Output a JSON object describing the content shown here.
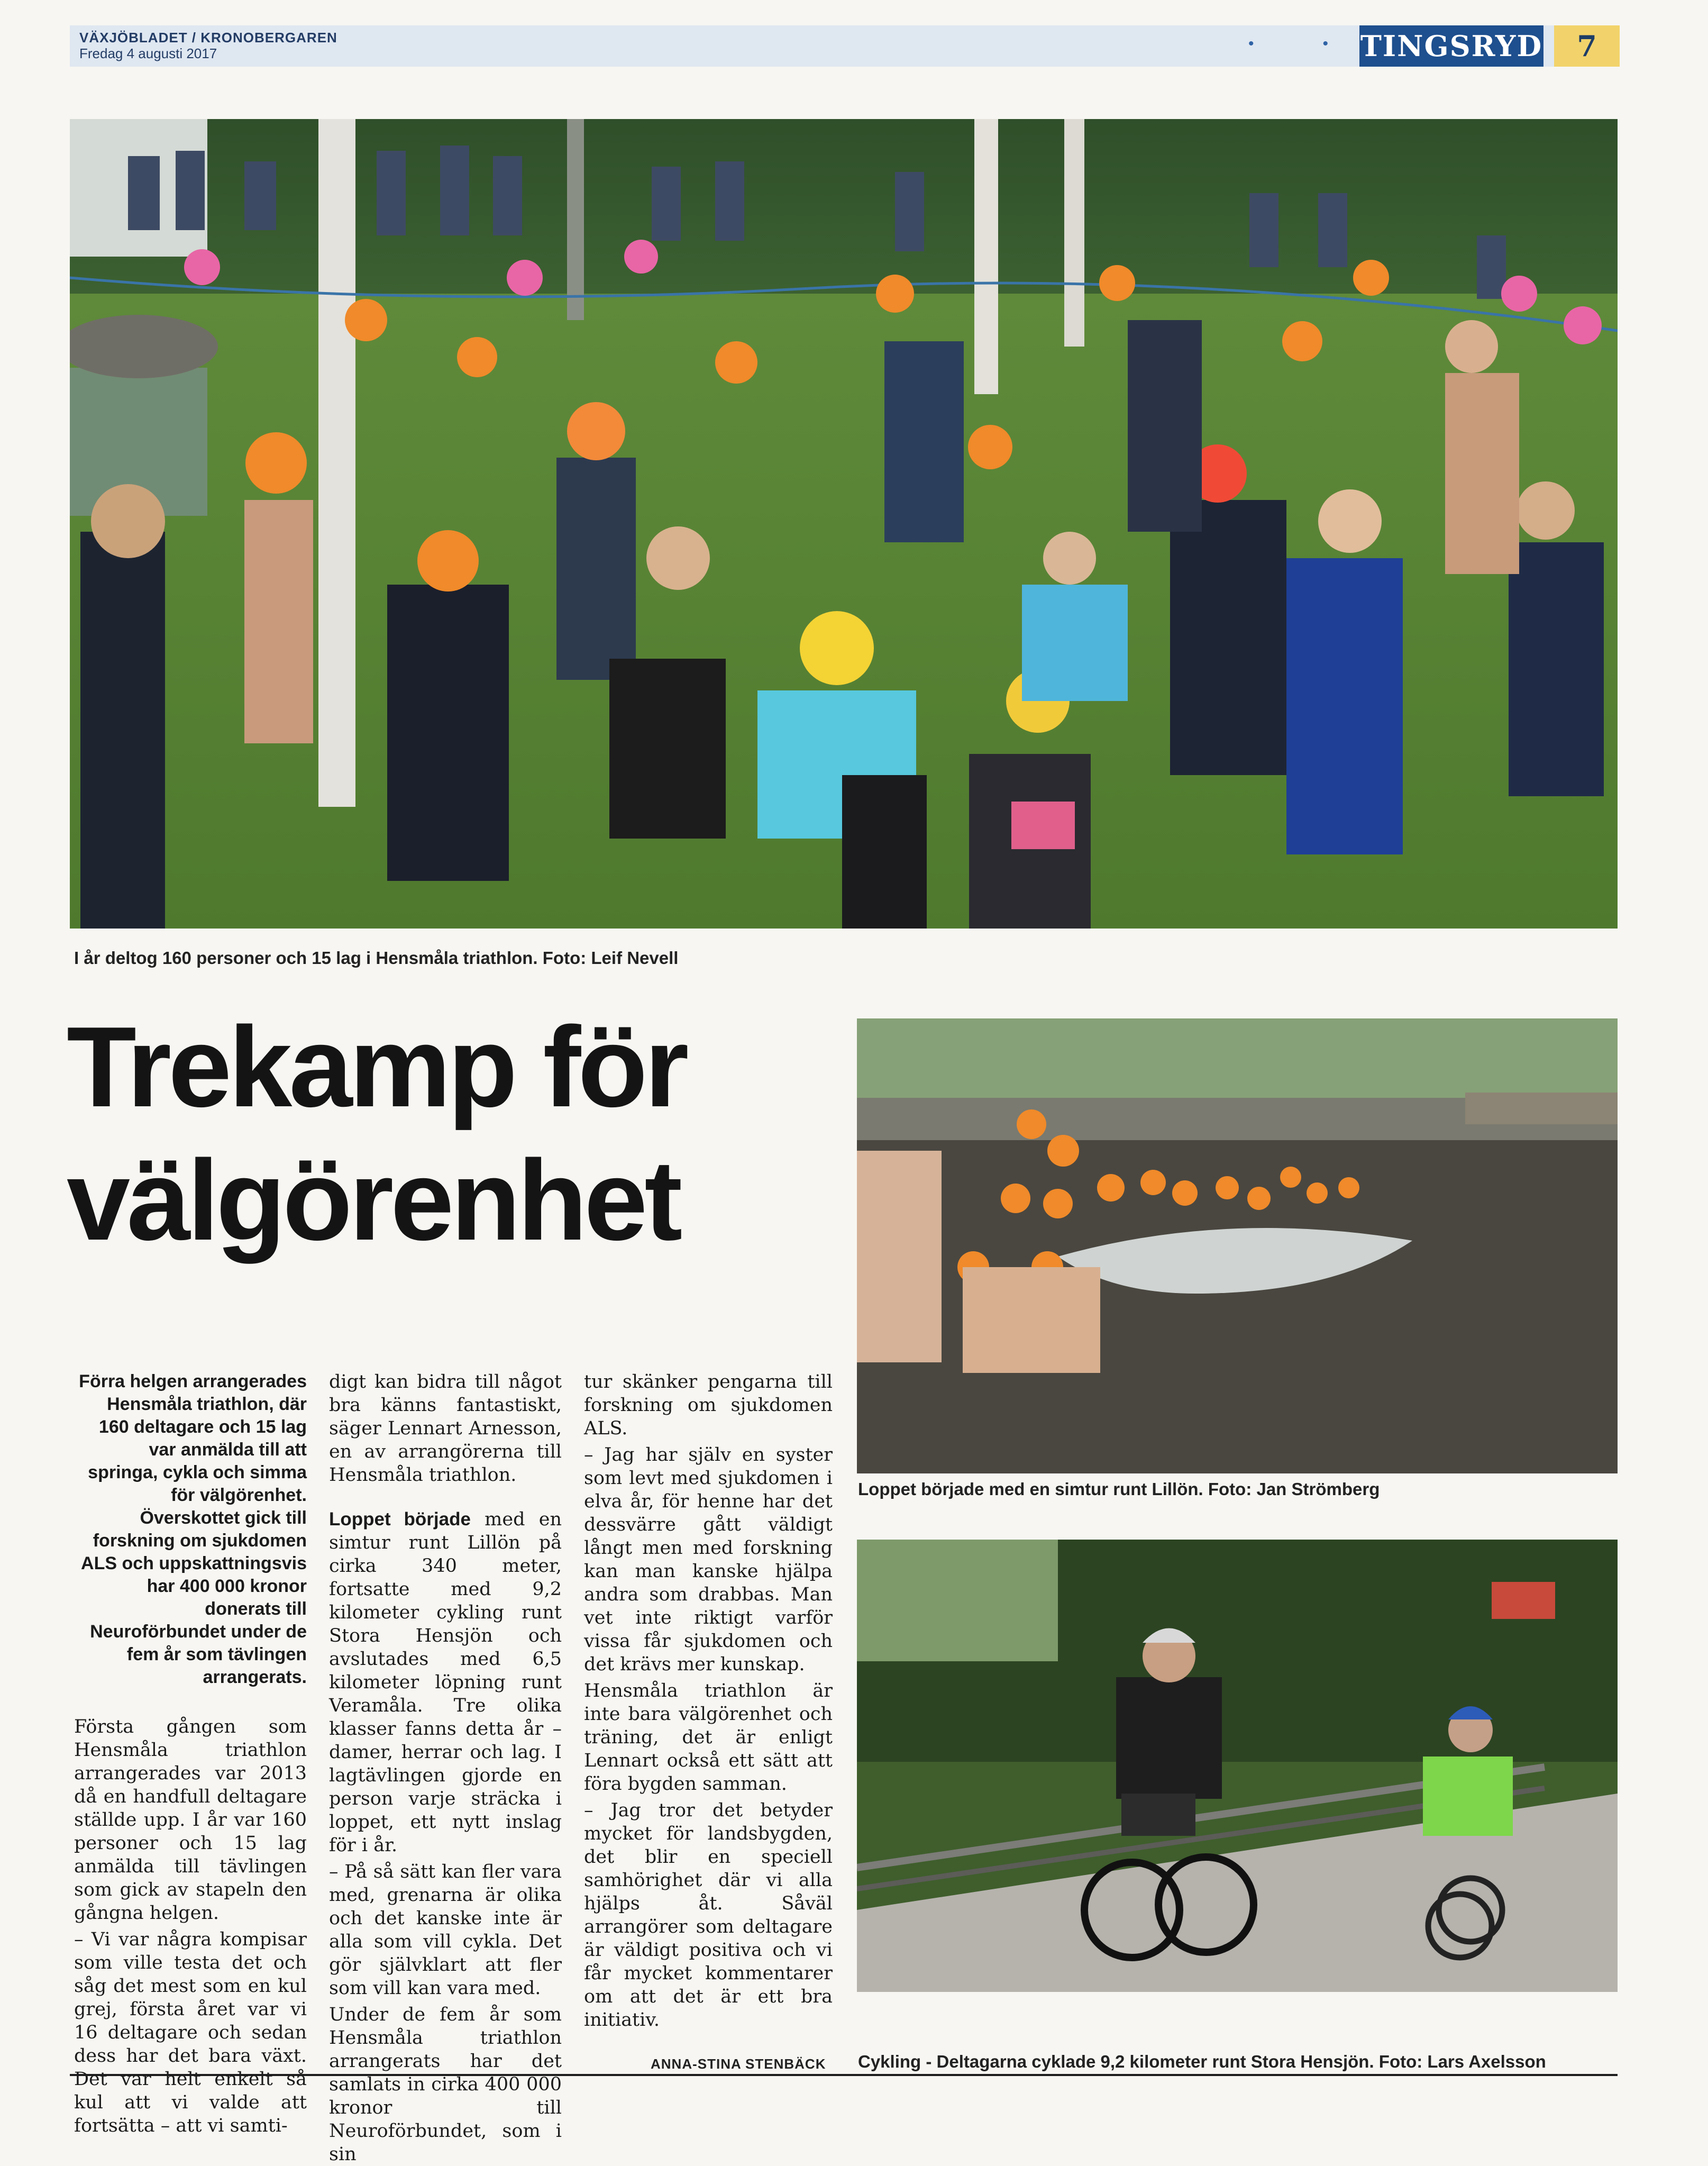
{
  "header": {
    "paper_name": "VÄXJÖBLADET / KRONOBERGAREN",
    "date": "Fredag 4 augusti 2017",
    "section": "TINGSRYD",
    "page_number": "7",
    "accent_color": "#1e4f8e",
    "page_badge_color": "#f2d36b"
  },
  "photos": {
    "main": {
      "caption": "I år deltog 160 personer och 15 lag i Hensmåla triathlon. Foto: Leif Nevell"
    },
    "swim": {
      "caption": "Loppet började med en simtur runt Lillön. Foto: Jan Strömberg"
    },
    "bike": {
      "caption": "Cykling - Deltagarna cyklade 9,2 kilometer runt Stora Hensjön. Foto: Lars Axelsson"
    }
  },
  "article": {
    "headline_line1": "Trekamp för",
    "headline_line2": "välgörenhet",
    "ingress": "Förra helgen arrangerades Hensmåla triathlon, där 160 deltagare och 15 lag var anmälda till att springa, cykla och simma för välgörenhet. Överskottet gick till forskning om sjukdomen ALS och uppskattningsvis har 400 000 kronor donerats till Neuroförbundet under de fem år som tävlingen arrangerats.",
    "col1": [
      "Första gången som Hensmåla triathlon arrangerades var 2013 då en handfull deltagare ställde upp. I år var 160 personer och 15 lag anmälda till tävlingen som gick av stapeln den gångna helgen.",
      "– Vi var några kompisar som ville testa det och såg det mest som en kul grej, första året var vi 16 deltagare och sedan dess har det bara växt. Det var helt enkelt så kul att vi valde att fortsätta – att vi samti-"
    ],
    "col2_p1": "digt kan bidra till något bra känns fantastiskt, säger Lennart Arnesson, en av arrangörerna till Hensmåla triathlon.",
    "col2_runin": "Loppet började",
    "col2_p2_rest": " med en simtur runt Lillön på cirka 340 meter, fortsatte med 9,2 kilometer cykling runt Stora Hensjön och avslutades med 6,5 kilometer löpning runt Veramåla. Tre olika klasser fanns detta år – damer, herrar och lag. I lagtävlingen gjorde en person varje sträcka i loppet, ett nytt inslag för i år.",
    "col2_more": [
      "– På så sätt kan fler vara med, grenarna är olika och det kanske inte är alla som vill cykla. Det gör självklart att fler som vill kan vara med.",
      "Under de fem år som Hensmåla triathlon arrangerats har det samlats in cirka 400 000 kronor till Neuroförbundet, som i sin"
    ],
    "col3": [
      "tur skänker pengarna till forskning om sjukdomen ALS.",
      "– Jag har själv en syster som levt med sjukdomen i elva år, för henne har det dessvärre gått väldigt långt men med forskning kan man kanske hjälpa andra som drabbas. Man vet inte riktigt varför vissa får sjukdomen och det krävs mer kunskap.",
      "Hensmåla triathlon är inte bara välgörenhet och träning, det är enligt Lennart också ett sätt att föra bygden samman.",
      "– Jag tror det betyder mycket för landsbygden, det blir en speciell samhörighet där vi alla hjälps åt. Såväl arrangörer som deltagare är väldigt positiva och vi får mycket kommentarer om att det är ett bra initiativ."
    ],
    "byline": "ANNA-STINA STENBÄCK"
  }
}
